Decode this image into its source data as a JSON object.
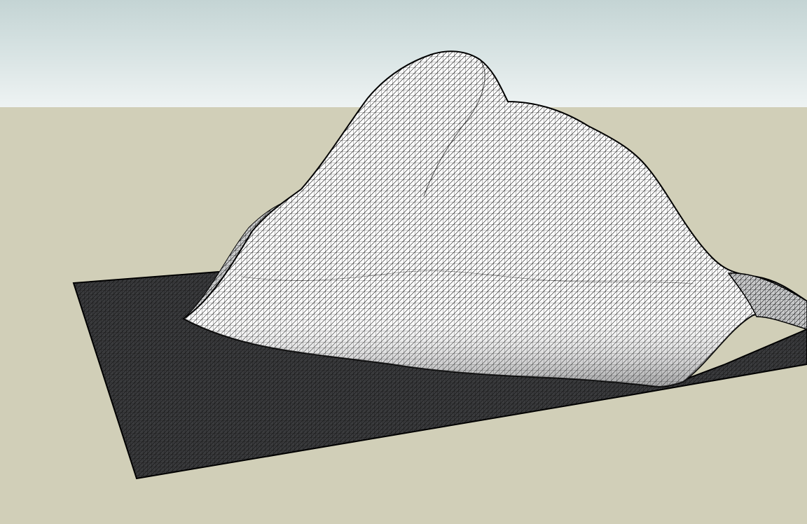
{
  "scene": {
    "colors": {
      "sky_top": "#c4d4d4",
      "sky_bottom": "#eef3f3",
      "ground": "#d1cfb8",
      "mesh_line": "#000000",
      "terrain_lit": "#ffffff",
      "terrain_shadow": "#3a3b3d"
    },
    "model": {
      "type": "triangulated terrain mesh",
      "style": "hidden-line wireframe"
    }
  }
}
